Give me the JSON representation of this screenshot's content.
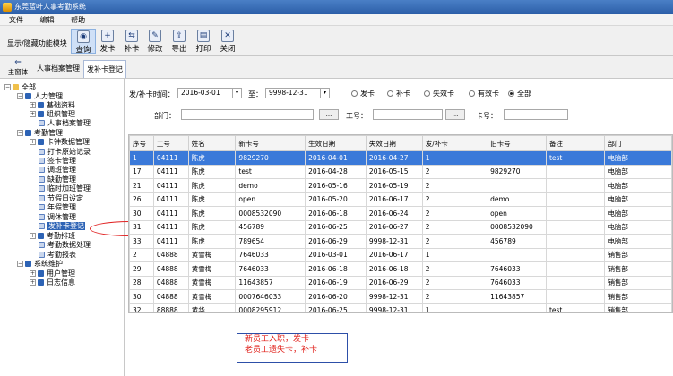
{
  "window": {
    "title": "东莞蓝叶人事考勤系统"
  },
  "menu": [
    "文件",
    "编辑",
    "帮助"
  ],
  "toolbar": {
    "toggle_label": "显示/隐藏功能模块",
    "buttons": [
      {
        "label": "查询",
        "icon": "binoculars-icon"
      },
      {
        "label": "发卡",
        "icon": "issue-card-icon"
      },
      {
        "label": "补卡",
        "icon": "reissue-card-icon"
      },
      {
        "label": "修改",
        "icon": "edit-icon"
      },
      {
        "label": "导出",
        "icon": "export-icon"
      },
      {
        "label": "打印",
        "icon": "print-icon"
      },
      {
        "label": "关闭",
        "icon": "close-icon"
      }
    ]
  },
  "tabs": {
    "home": "主窗体",
    "items": [
      "人事档案管理",
      "发补卡登记"
    ]
  },
  "tree": {
    "root": "全部",
    "nodes": [
      "人力管理",
      "基础资料",
      "组织管理",
      "人事档案管理",
      "考勤管理",
      "卡钟数据管理",
      "打卡原始记录",
      "签卡管理",
      "调班管理",
      "缺勤管理",
      "临时加班管理",
      "节假日设定",
      "年假管理",
      "调休管理",
      "发补卡登记",
      "考勤排班",
      "考勤数据处理",
      "考勤报表",
      "系统维护",
      "用户管理",
      "日志信息"
    ]
  },
  "filter": {
    "date_label": "发/补卡时间：",
    "date_from": "2016-03-01",
    "to_label": "至：",
    "date_to": "9998-12-31",
    "radios": [
      "发卡",
      "补卡",
      "失效卡",
      "有效卡",
      "全部"
    ],
    "selected_radio": "全部",
    "dept_label": "部门：",
    "dept_value": "",
    "browse": "...",
    "empno_label": "工号：",
    "empno_value": "",
    "card_label": "卡号：",
    "card_value": ""
  },
  "grid": {
    "columns": [
      "序号",
      "工号",
      "姓名",
      "新卡号",
      "生效日期",
      "失效日期",
      "发/补卡",
      "旧卡号",
      "备注",
      "部门"
    ],
    "rows": [
      [
        "1",
        "04111",
        "陈虎",
        "9829270",
        "2016-04-01",
        "2016-04-27",
        "1",
        "",
        "test",
        "电脑部"
      ],
      [
        "17",
        "04111",
        "陈虎",
        "test",
        "2016-04-28",
        "2016-05-15",
        "2",
        "9829270",
        "",
        "电脑部"
      ],
      [
        "21",
        "04111",
        "陈虎",
        "demo",
        "2016-05-16",
        "2016-05-19",
        "2",
        "",
        "",
        "电脑部"
      ],
      [
        "26",
        "04111",
        "陈虎",
        "open",
        "2016-05-20",
        "2016-06-17",
        "2",
        "demo",
        "",
        "电脑部"
      ],
      [
        "30",
        "04111",
        "陈虎",
        "0008532090",
        "2016-06-18",
        "2016-06-24",
        "2",
        "open",
        "",
        "电脑部"
      ],
      [
        "31",
        "04111",
        "陈虎",
        "456789",
        "2016-06-25",
        "2016-06-27",
        "2",
        "0008532090",
        "",
        "电脑部"
      ],
      [
        "33",
        "04111",
        "陈虎",
        "789654",
        "2016-06-29",
        "9998-12-31",
        "2",
        "456789",
        "",
        "电脑部"
      ],
      [
        "2",
        "04888",
        "黄雪梅",
        "7646033",
        "2016-03-01",
        "2016-06-17",
        "1",
        "",
        "",
        "销售部"
      ],
      [
        "29",
        "04888",
        "黄雪梅",
        "7646033",
        "2016-06-18",
        "2016-06-18",
        "2",
        "7646033",
        "",
        "销售部"
      ],
      [
        "28",
        "04888",
        "黄雪梅",
        "11643857",
        "2016-06-19",
        "2016-06-29",
        "2",
        "7646033",
        "",
        "销售部"
      ],
      [
        "30",
        "04888",
        "黄雪梅",
        "0007646033",
        "2016-06-20",
        "9998-12-31",
        "2",
        "11643857",
        "",
        "销售部"
      ],
      [
        "32",
        "88888",
        "黄华",
        "0008295912",
        "2016-06-25",
        "9998-12-31",
        "1",
        "",
        "test",
        "销售部"
      ]
    ]
  },
  "note": [
    "新员工入职，发卡",
    "老员工遗失卡，补卡"
  ],
  "colors": {
    "title_bar": "#2b5ea8",
    "selection": "#3a79d9",
    "note_text": "#e0201a",
    "note_border": "#2d4fa8",
    "circle": "#e02020"
  }
}
